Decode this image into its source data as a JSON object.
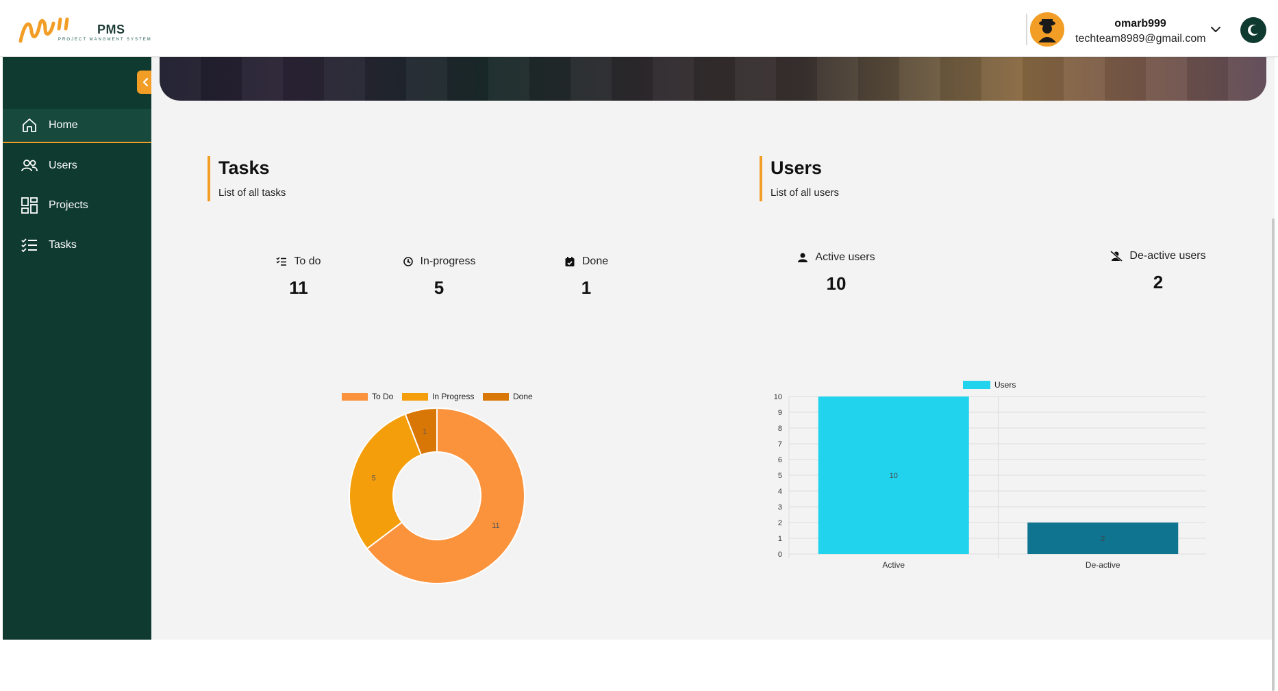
{
  "header": {
    "brand": "PMS",
    "brand_tagline": "PROJECT MANGMENT SYSTEM",
    "user_name": "omarb999",
    "user_email": "techteam8989@gmail.com",
    "icons": [
      "logo-icon",
      "avatar",
      "chevron-down-icon",
      "moon-icon"
    ]
  },
  "sidebar": {
    "items": [
      {
        "label": "Home",
        "icon": "home-icon",
        "active": true
      },
      {
        "label": "Users",
        "icon": "users-icon",
        "active": false
      },
      {
        "label": "Projects",
        "icon": "projects-icon",
        "active": false
      },
      {
        "label": "Tasks",
        "icon": "tasks-icon",
        "active": false
      }
    ]
  },
  "tasks_section": {
    "title": "Tasks",
    "subtitle": "List of all tasks",
    "stats": [
      {
        "label": "To do",
        "value": "11",
        "icon": "todo-list-icon"
      },
      {
        "label": "In-progress",
        "value": "5",
        "icon": "progress-icon"
      },
      {
        "label": "Done",
        "value": "1",
        "icon": "calendar-check-icon"
      }
    ]
  },
  "users_section": {
    "title": "Users",
    "subtitle": "List of all users",
    "stats": [
      {
        "label": "Active users",
        "value": "10",
        "icon": "user-icon"
      },
      {
        "label": "De-active users",
        "value": "2",
        "icon": "user-slash-icon"
      }
    ]
  },
  "colors": {
    "sidebar": "#0f3a2f",
    "accent": "#f29e26",
    "todo": "#fb923c",
    "in_progress": "#f59e0b",
    "done": "#d97706",
    "active_bar": "#22d3ee",
    "deactive_bar": "#0e7490"
  },
  "chart_data": [
    {
      "type": "pie",
      "donut": true,
      "labels": [
        "To Do",
        "In Progress",
        "Done"
      ],
      "values": [
        11,
        5,
        1
      ],
      "legend": "top"
    },
    {
      "type": "bar",
      "categories": [
        "Active",
        "De-active"
      ],
      "series": [
        {
          "name": "Users",
          "values": [
            10,
            2
          ]
        }
      ],
      "ylim": [
        0,
        10
      ],
      "yticks": [
        0,
        1,
        2,
        3,
        4,
        5,
        6,
        7,
        8,
        9,
        10
      ],
      "grid": true,
      "legend": "top"
    }
  ]
}
